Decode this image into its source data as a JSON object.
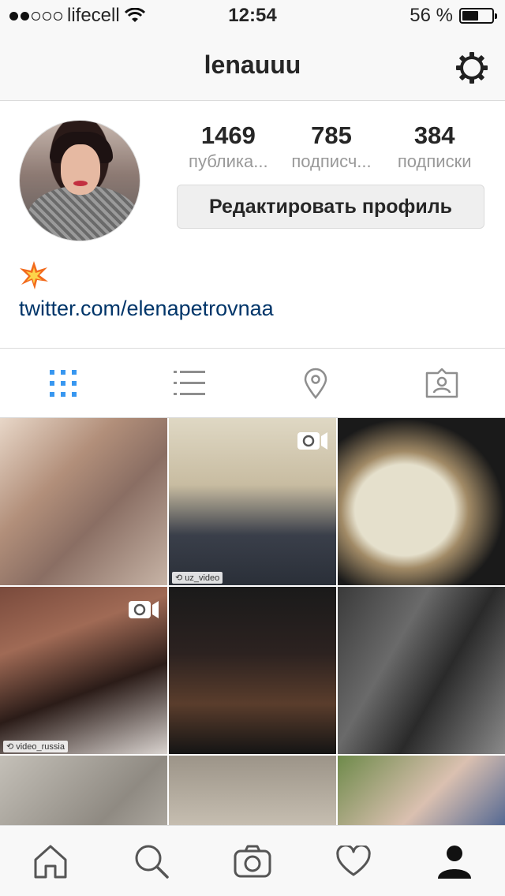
{
  "status_bar": {
    "carrier": "lifecell",
    "time": "12:54",
    "battery_percent_text": "56 %",
    "battery_level": 0.56,
    "signal_strength": 2
  },
  "nav": {
    "title": "lenauuu",
    "settings_icon": "gear-icon"
  },
  "profile": {
    "stats": [
      {
        "value": "1469",
        "label": "публика..."
      },
      {
        "value": "785",
        "label": "подписч..."
      },
      {
        "value": "384",
        "label": "подписки"
      }
    ],
    "edit_button_label": "Редактировать профиль",
    "bio_emoji": "collision-emoji",
    "bio_link": "twitter.com/elenapetrovnaa"
  },
  "view_tabs": [
    {
      "icon": "grid-icon",
      "active": true
    },
    {
      "icon": "list-icon",
      "active": false
    },
    {
      "icon": "location-pin-icon",
      "active": false
    },
    {
      "icon": "tagged-photos-icon",
      "active": false
    }
  ],
  "posts": [
    {
      "type": "photo"
    },
    {
      "type": "video",
      "repost_user": "uz_video"
    },
    {
      "type": "photo"
    },
    {
      "type": "video",
      "repost_user": "video_russia"
    },
    {
      "type": "photo"
    },
    {
      "type": "photo"
    },
    {
      "type": "photo"
    },
    {
      "type": "photo"
    },
    {
      "type": "photo"
    }
  ],
  "bottom_tabs": [
    {
      "icon": "home-icon",
      "active": false
    },
    {
      "icon": "search-icon",
      "active": false
    },
    {
      "icon": "camera-icon",
      "active": false
    },
    {
      "icon": "heart-icon",
      "active": false
    },
    {
      "icon": "profile-icon",
      "active": true
    }
  ],
  "colors": {
    "accent": "#3897f0",
    "link": "#003569",
    "secondary_text": "#999999",
    "icon_gray": "#8e8e8e"
  }
}
